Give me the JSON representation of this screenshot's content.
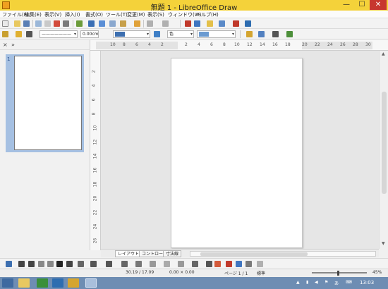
{
  "window": {
    "title": "無題 1 - LibreOffice Draw",
    "minimize": "—",
    "maximize": "☐",
    "close": "✕"
  },
  "menu": [
    "ファイル(F)",
    "編集(E)",
    "表示(V)",
    "挿入(I)",
    "書式(O)",
    "ツール(T)",
    "変更(M)",
    "表示(S)",
    "ウィンドウ(W)",
    "ヘルプ(H)"
  ],
  "toolbar2": {
    "line_style": "———————",
    "line_width": "0.00cm",
    "fill_type": "色",
    "area_color": "",
    "shadow_value": ""
  },
  "ruler": {
    "h_ticks": [
      "10",
      "8",
      "6",
      "4",
      "2",
      "2",
      "4",
      "6",
      "8",
      "10",
      "12",
      "14",
      "16",
      "18",
      "20",
      "22",
      "24",
      "26",
      "28",
      "30"
    ],
    "v_ticks": [
      "2",
      "4",
      "6",
      "8",
      "10",
      "12",
      "14",
      "16",
      "18",
      "20",
      "22",
      "24",
      "26"
    ]
  },
  "pages_panel": {
    "close": "×",
    "expand": "»",
    "page_number": "1"
  },
  "tabs": [
    "レイアウト",
    "コントロール",
    "寸法線"
  ],
  "status": {
    "position": "30.19 / 17.09",
    "size": "0.00 × 0.00",
    "page": "ページ 1 / 1",
    "mode": "標準",
    "zoom": "45%"
  },
  "taskbar": {
    "clock": "13:03"
  },
  "colors": {
    "titlebar": "#f4d23a",
    "taskbar": "#6e8db3",
    "selection": "#a5c0e2",
    "close_button": "#c7372f"
  }
}
